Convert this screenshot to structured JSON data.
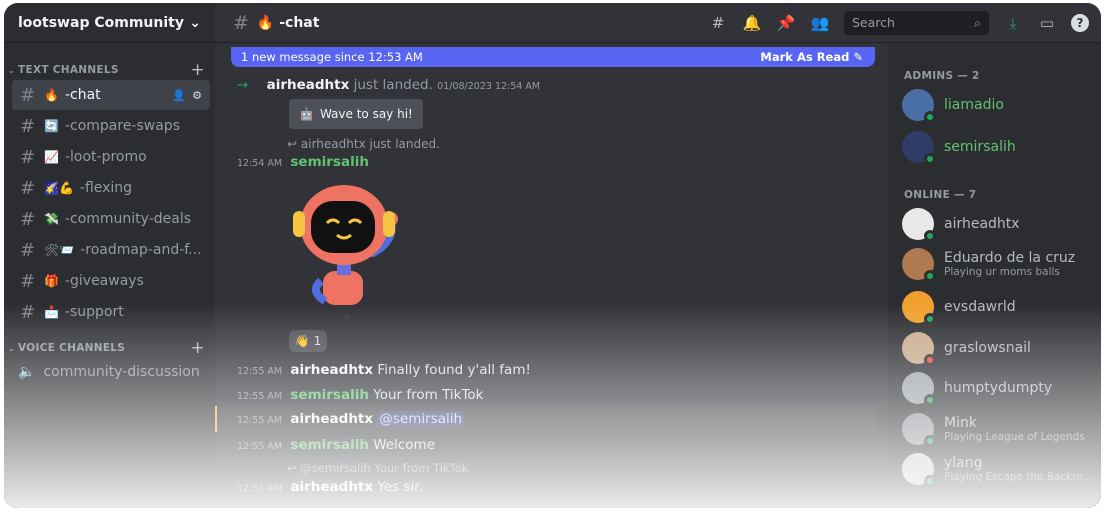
{
  "server": {
    "name": "lootswap Community"
  },
  "categories": {
    "text": "TEXT CHANNELS",
    "voice": "VOICE CHANNELS"
  },
  "channels": [
    {
      "emoji": "🔥",
      "name": "-chat"
    },
    {
      "emoji": "🔄",
      "name": "-compare-swaps"
    },
    {
      "emoji": "📈",
      "name": "-loot-promo"
    },
    {
      "emoji": "🌠💪",
      "name": "-flexing"
    },
    {
      "emoji": "💸",
      "name": "-community-deals"
    },
    {
      "emoji": "🛠📨",
      "name": "-roadmap-and-f..."
    },
    {
      "emoji": "🎁",
      "name": "-giveaways"
    },
    {
      "emoji": "📩",
      "name": "-support"
    }
  ],
  "voice_channels": [
    {
      "name": "community-discussion"
    }
  ],
  "topbar": {
    "channel": "🔥 -chat",
    "search_placeholder": "Search"
  },
  "newbar": {
    "text": "1 new message since 12:53 AM",
    "action": "Mark As Read"
  },
  "messages": {
    "join": {
      "user": "airheadhtx",
      "text": "just landed.",
      "ts": "01/08/2023 12:54 AM"
    },
    "wave_button": "Wave to say hi!",
    "reply_ref": "airheadhtx just landed.",
    "sticker_msg": {
      "ts": "12:54 AM",
      "user": "semirsalih"
    },
    "reaction": {
      "emoji": "👋",
      "count": "1"
    },
    "m1": {
      "ts": "12:55 AM",
      "user": "airheadhtx",
      "text": "Finally found y'all fam!"
    },
    "m2": {
      "ts": "12:55 AM",
      "user": "semirsalih",
      "text": "Your from TikTok"
    },
    "m3": {
      "ts": "12:55 AM",
      "user": "airheadhtx",
      "text": "@semirsalih"
    },
    "m4": {
      "ts": "12:55 AM",
      "user": "semirsalih",
      "text": "Welcome"
    },
    "reply2": "@semirsalih Your from TikTok",
    "m5": {
      "ts": "12:55 AM",
      "user": "airheadhtx",
      "text": "Yes sir."
    }
  },
  "members": {
    "admins_header": "ADMINS — 2",
    "online_header": "ONLINE — 7",
    "admins": [
      {
        "name": "liamadio"
      },
      {
        "name": "semirsalih"
      }
    ],
    "online": [
      {
        "name": "airheadhtx",
        "activity": ""
      },
      {
        "name": "Eduardo de la cruz",
        "activity": "Playing ur moms balls"
      },
      {
        "name": "evsdawrld",
        "activity": ""
      },
      {
        "name": "graslowsnail",
        "activity": ""
      },
      {
        "name": "humptydumpty",
        "activity": ""
      },
      {
        "name": "Mink",
        "activity": "Playing League of Legends"
      },
      {
        "name": "ylang",
        "activity": "Playing Escape the Backro..."
      }
    ]
  },
  "colors": {
    "accent": "#5865f2",
    "online": "#23a55a",
    "admin": "#63c26f"
  }
}
